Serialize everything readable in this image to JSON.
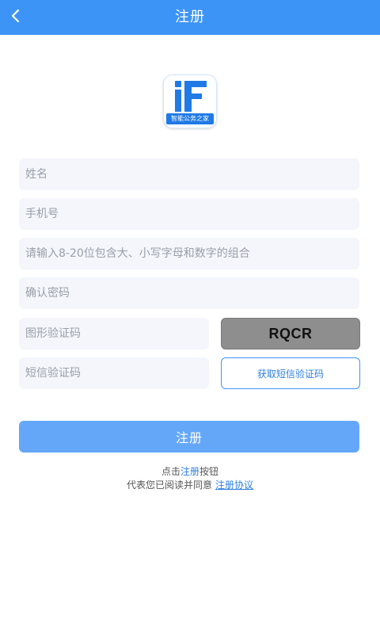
{
  "header": {
    "title": "注册",
    "background": "#3d94f7"
  },
  "logo": {
    "mark": "iF",
    "label": "智能公务之家"
  },
  "form": {
    "name_placeholder": "姓名",
    "phone_placeholder": "手机号",
    "password_placeholder": "请输入8-20位包含大、小写字母和数字的组合",
    "confirm_placeholder": "确认密码",
    "captcha_placeholder": "图形验证码",
    "sms_placeholder": "短信验证码",
    "captcha_text": "RQCR",
    "sms_button": "获取短信验证码",
    "register_button": "注册"
  },
  "agreement": {
    "line1_prefix": "点击",
    "line1_link": "注册",
    "line1_suffix": "按钮",
    "line2_prefix": "代表您已阅读并同意",
    "line2_link": "注册协议"
  },
  "colors": {
    "accent": "#3d94f7",
    "button": "#64a7f8",
    "link": "#2f7fe0"
  }
}
